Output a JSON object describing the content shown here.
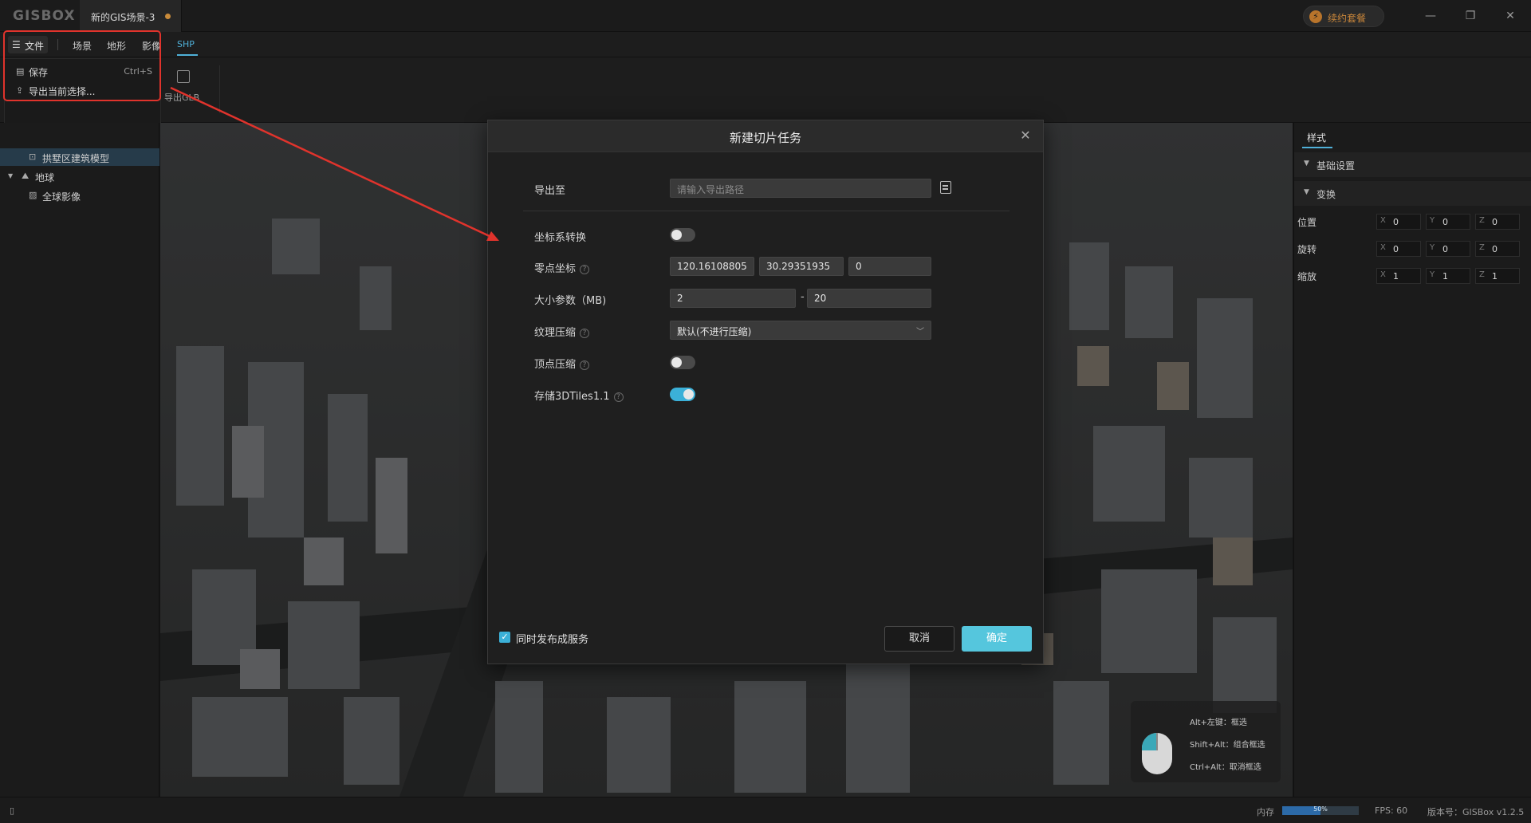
{
  "app": {
    "logo": "GISBOX",
    "doc_tab": "新的GIS场景-3",
    "renew_label": "续约套餐"
  },
  "menu": {
    "file": "文件",
    "items": [
      "场景",
      "地形",
      "影像"
    ],
    "active_tab": "SHP"
  },
  "toolbar": {
    "export_label": "导出GLB"
  },
  "file_menu": {
    "items": [
      {
        "label": "保存",
        "shortcut": "Ctrl+S"
      },
      {
        "label": "导出当前选择..."
      }
    ]
  },
  "tree": {
    "items": [
      {
        "label": "拱墅区建筑模型",
        "selected": true
      },
      {
        "label": "地球"
      },
      {
        "label": "全球影像"
      }
    ]
  },
  "right_panel": {
    "tab": "样式",
    "sections": [
      "基础设置",
      "变换"
    ],
    "props": [
      {
        "label": "位置",
        "x": "0",
        "y": "0",
        "z": "0"
      },
      {
        "label": "旋转",
        "x": "0",
        "y": "0",
        "z": "0"
      },
      {
        "label": "缩放",
        "x": "1",
        "y": "1",
        "z": "1"
      }
    ],
    "axes": [
      "X",
      "Y",
      "Z"
    ]
  },
  "mouse_hint": {
    "rows": [
      "Alt+左键：框选",
      "Shift+Alt：组合框选",
      "Ctrl+Alt：取消框选"
    ]
  },
  "status": {
    "memory_label": "内存",
    "memory_pct": "50%",
    "memory_fraction": 0.5,
    "fps": "FPS: 60",
    "version": "版本号：GISBox v1.2.5"
  },
  "dialog": {
    "title": "新建切片任务",
    "export_label": "导出至",
    "export_placeholder": "请输入导出路径",
    "coord_label": "坐标系转换",
    "coord_on": false,
    "origin_label": "零点坐标",
    "origin_values": [
      "120.16108805",
      "30.29351935",
      "0"
    ],
    "size_label": "大小参数（MB)",
    "size_min": "2",
    "size_dash": "-",
    "size_max": "20",
    "texture_label": "纹理压缩",
    "texture_value": "默认(不进行压缩)",
    "vertex_label": "顶点压缩",
    "vertex_on": false,
    "tiles_label": "存储3DTiles1.1",
    "tiles_on": true,
    "publish_label": "同时发布成服务",
    "publish_checked": true,
    "cancel": "取消",
    "ok": "确定"
  },
  "colors": {
    "accent": "#3bb0d8",
    "ok_button": "#55c6dd",
    "annotation": "#e0332c"
  }
}
